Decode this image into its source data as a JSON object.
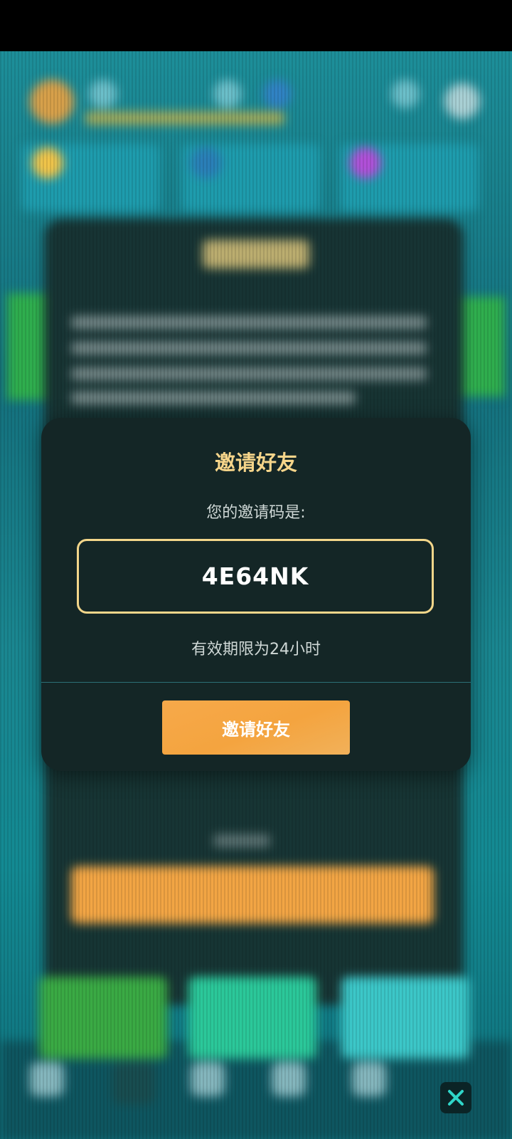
{
  "dialog": {
    "title": "邀请好友",
    "subtitle": "您的邀请码是:",
    "invite_code": "4E64NK",
    "validity_note": "有效期限为24小时",
    "invite_button_label": "邀请好友"
  },
  "colors": {
    "dialog_bg": "#142626",
    "title_gold": "#f6d58a",
    "code_border": "#f3d68a",
    "button_orange": "#f4a43f",
    "close_button_bg": "#0b2426",
    "close_icon": "#2fd6c9"
  },
  "icons": {
    "close": "close-icon"
  }
}
